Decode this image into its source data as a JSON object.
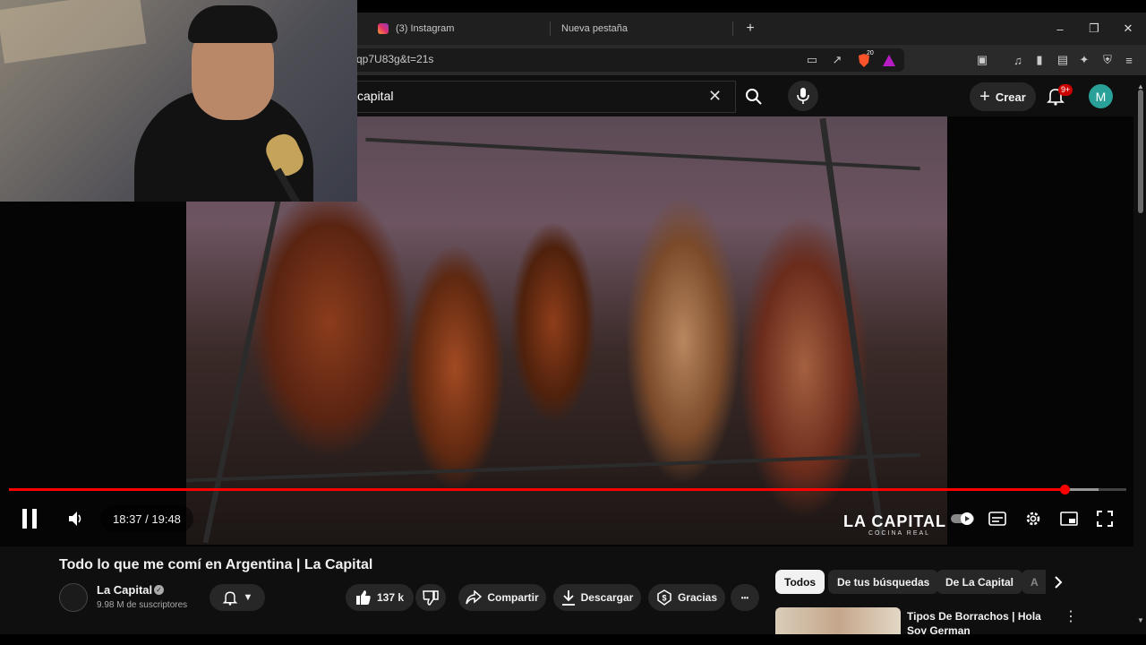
{
  "browser": {
    "tabs": [
      {
        "title": "(3) Instagram"
      },
      {
        "title": "Nueva pestaña"
      }
    ],
    "new_tab_glyph": "+",
    "url": "qp7U83g&t=21s",
    "shield_count": "20",
    "window": {
      "minimize": "–",
      "restore": "❐",
      "close": "✕"
    }
  },
  "youtube": {
    "search_query": "capital",
    "create_label": "Crear",
    "notifications_badge": "9+",
    "avatar_letter": "M"
  },
  "player": {
    "time": "18:37 / 19:48",
    "played_fraction": 0.945,
    "buffered_fraction": 0.975,
    "watermark_title": "LA CAPITAL",
    "watermark_subtitle": "COCINA REAL",
    "playing": true
  },
  "video": {
    "title": "Todo lo que me comí en Argentina | La Capital",
    "channel": "La Capital",
    "subscribers": "9.98 M de suscriptores",
    "likes": "137 k",
    "share_label": "Compartir",
    "download_label": "Descargar",
    "thanks_label": "Gracias",
    "more_glyph": "•••"
  },
  "chips": [
    "Todos",
    "De tus búsquedas",
    "De La Capital",
    "A"
  ],
  "recommended": [
    {
      "title": "Tipos De Borrachos | Hola Soy German"
    }
  ],
  "colors": {
    "accent": "#ff0000",
    "background": "#0f0f0f",
    "chip_active_bg": "#f1f1f1",
    "avatar": "#2aa198"
  },
  "icons": [
    "instagram-icon",
    "search-icon",
    "mic-icon",
    "bell-icon",
    "pause-icon",
    "volume-icon",
    "autoplay-icon",
    "subtitles-icon",
    "settings-icon",
    "miniplayer-icon",
    "fullscreen-icon",
    "like-icon",
    "dislike-icon",
    "share-icon",
    "download-icon",
    "thanks-icon",
    "chevron-right-icon"
  ]
}
